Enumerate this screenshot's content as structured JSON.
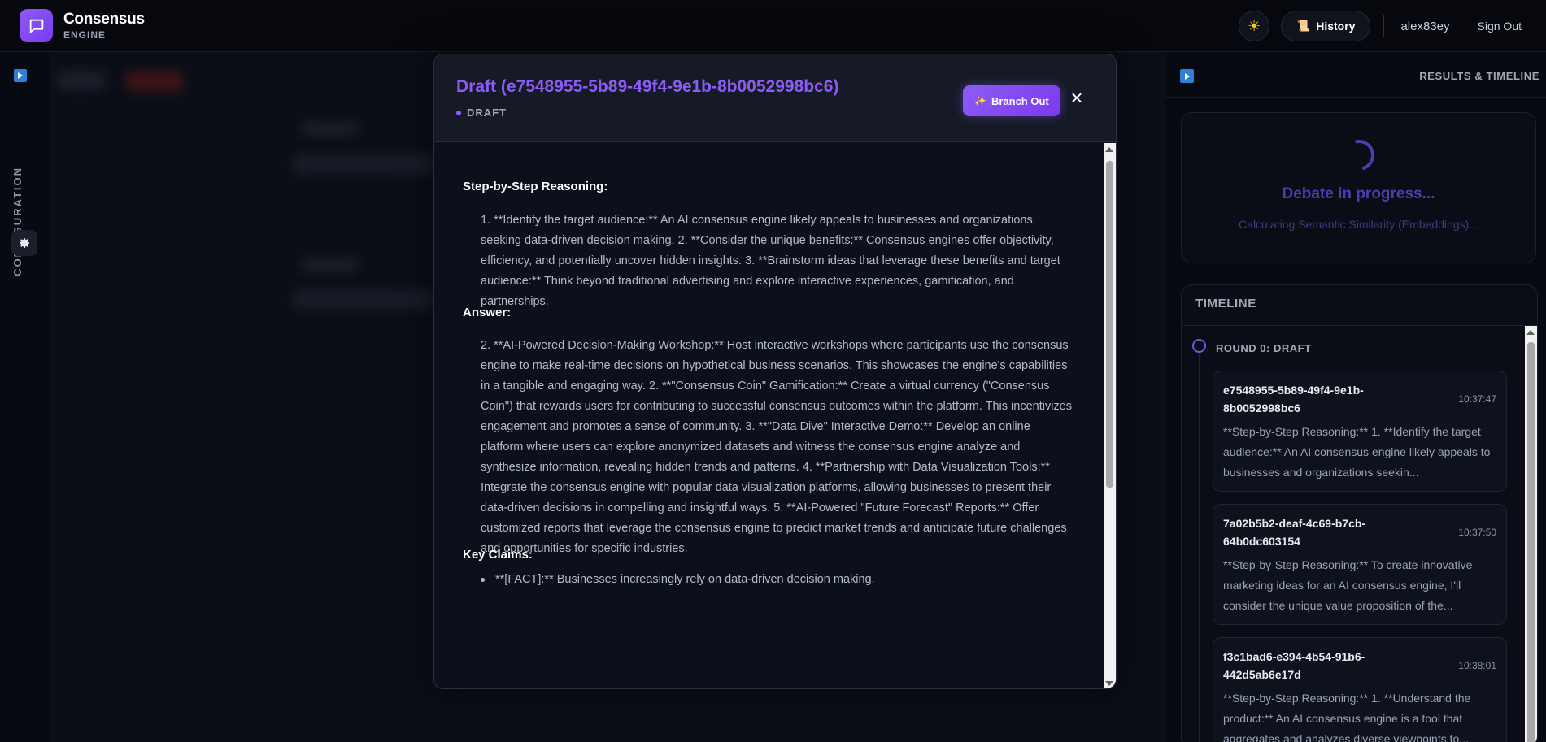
{
  "app": {
    "name": "Consensus",
    "subtitle": "ENGINE"
  },
  "topbar": {
    "history_label": "History",
    "username": "alex83ey",
    "signout_label": "Sign Out"
  },
  "left_rail": {
    "label": "CONFIGURATION"
  },
  "modal": {
    "title": "Draft (e7548955-5b89-49f4-9e1b-8b0052998bc6)",
    "status": "DRAFT",
    "branch_label": "Branch Out",
    "reasoning_heading": "Step-by-Step Reasoning:",
    "reasoning_text": "1. **Identify the target audience:** An AI consensus engine likely appeals to businesses and organizations seeking data-driven decision making. 2. **Consider the unique benefits:** Consensus engines offer objectivity, efficiency, and potentially uncover hidden insights. 3. **Brainstorm ideas that leverage these benefits and target audience:** Think beyond traditional advertising and explore interactive experiences, gamification, and partnerships.",
    "answer_heading": "Answer:",
    "answer_text": "2. **AI-Powered Decision-Making Workshop:** Host interactive workshops where participants use the consensus engine to make real-time decisions on hypothetical business scenarios. This showcases the engine's capabilities in a tangible and engaging way. 2. **\"Consensus Coin\" Gamification:** Create a virtual currency (\"Consensus Coin\") that rewards users for contributing to successful consensus outcomes within the platform. This incentivizes engagement and promotes a sense of community. 3. **\"Data Dive\" Interactive Demo:** Develop an online platform where users can explore anonymized datasets and witness the consensus engine analyze and synthesize information, revealing hidden trends and patterns. 4. **Partnership with Data Visualization Tools:** Integrate the consensus engine with popular data visualization platforms, allowing businesses to present their data-driven decisions in compelling and insightful ways. 5. **AI-Powered \"Future Forecast\" Reports:** Offer customized reports that leverage the consensus engine to predict market trends and anticipate future challenges and opportunities for specific industries.",
    "claims_heading": "Key Claims:",
    "claims": [
      "**[FACT]:** Businesses increasingly rely on data-driven decision making."
    ]
  },
  "results_panel": {
    "title": "RESULTS & TIMELINE",
    "progress_title": "Debate in progress...",
    "progress_sub": "Calculating Semantic Similarity (Embeddings)...",
    "timeline_title": "TIMELINE",
    "round_label": "ROUND 0: DRAFT",
    "items": [
      {
        "id": "e7548955-5b89-49f4-9e1b-8b0052998bc6",
        "time": "10:37:47",
        "text": "**Step-by-Step Reasoning:** 1. **Identify the target audience:** An AI consensus engine likely appeals to businesses and organizations seekin..."
      },
      {
        "id": "7a02b5b2-deaf-4c69-b7cb-64b0dc603154",
        "time": "10:37:50",
        "text": "**Step-by-Step Reasoning:** To create innovative marketing ideas for an AI consensus engine, I'll consider the unique value proposition of the..."
      },
      {
        "id": "f3c1bad6-e394-4b54-91b6-442d5ab6e17d",
        "time": "10:38:01",
        "text": "**Step-by-Step Reasoning:** 1. **Understand the product:** An AI consensus engine is a tool that aggregates and analyzes diverse viewpoints to..."
      }
    ]
  },
  "colors": {
    "accent": "#8b5cf6",
    "background": "#0b0e16",
    "panel": "#070a10"
  }
}
